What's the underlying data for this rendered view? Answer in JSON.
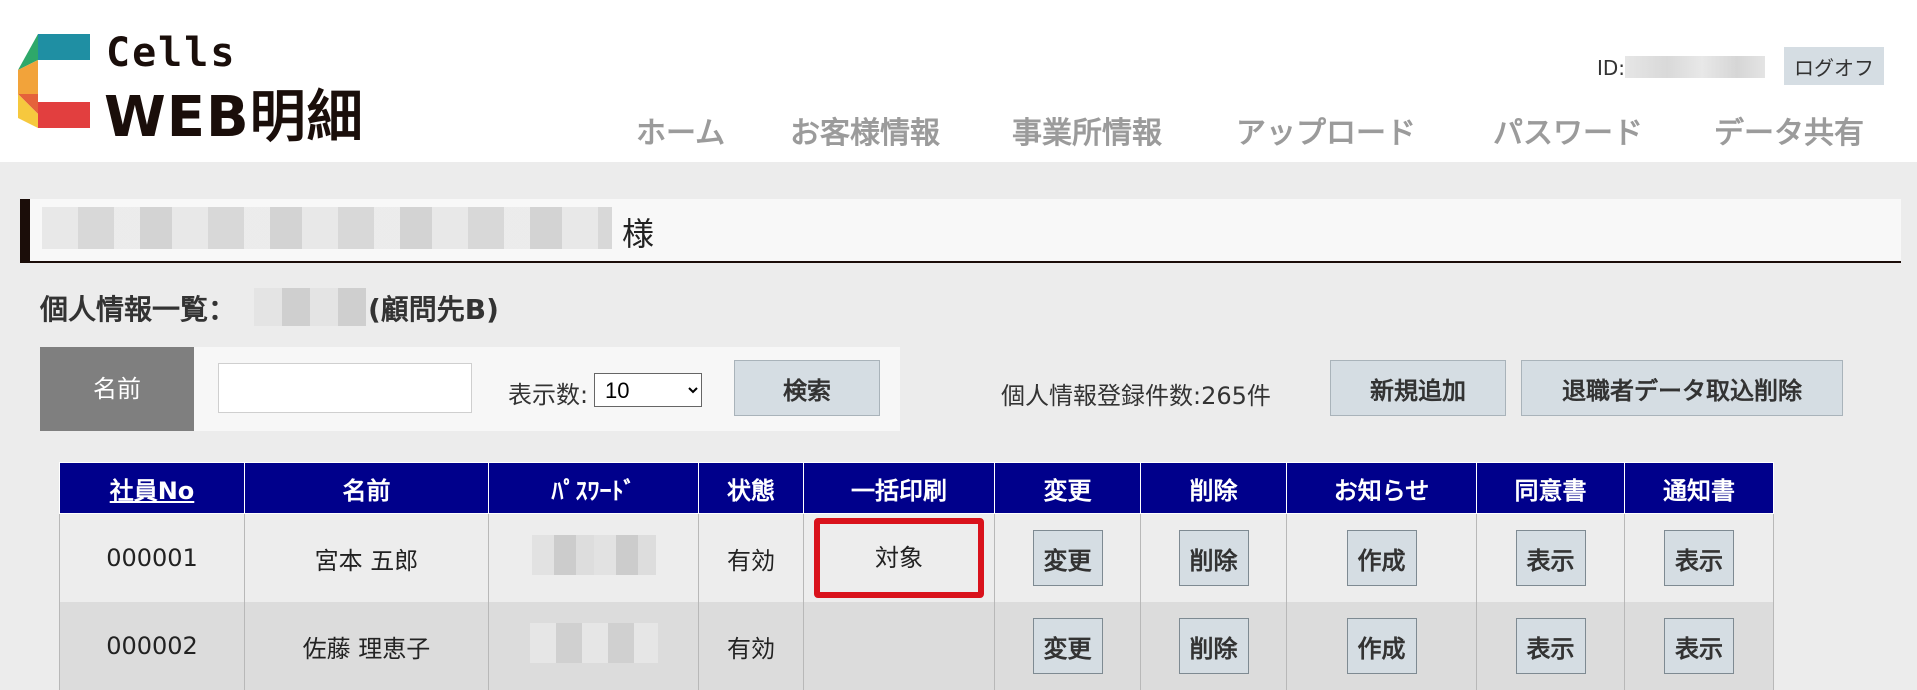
{
  "header": {
    "logo_cells": "Cells",
    "logo_web": "WEB明細",
    "id_label": "ID:",
    "logoff_label": "ログオフ",
    "nav": [
      "ホーム",
      "お客様情報",
      "事業所情報",
      "アップロード",
      "パスワード",
      "データ共有"
    ]
  },
  "title": {
    "suffix": "様"
  },
  "subtitle": {
    "prefix": "個人情報一覧：",
    "client": "(顧問先B)"
  },
  "search": {
    "name_label": "名前",
    "name_value": "",
    "perpage_label": "表示数:",
    "perpage_value": "10",
    "search_label": "検索"
  },
  "actions": {
    "count_text": "個人情報登録件数:265件",
    "add_label": "新規追加",
    "retire_label": "退職者データ取込削除"
  },
  "table": {
    "headers": [
      "社員No",
      "名前",
      "ﾊﾟｽﾜｰﾄﾞ",
      "状態",
      "一括印刷",
      "変更",
      "削除",
      "お知らせ",
      "同意書",
      "通知書"
    ],
    "rows": [
      {
        "no": "000001",
        "name": "宮本 五郎",
        "status": "有効",
        "bulk": "対象",
        "change": "変更",
        "delete": "削除",
        "notice": "作成",
        "consent": "表示",
        "notify": "表示"
      },
      {
        "no": "000002",
        "name": "佐藤 理恵子",
        "status": "有効",
        "bulk": "",
        "change": "変更",
        "delete": "削除",
        "notice": "作成",
        "consent": "表示",
        "notify": "表示"
      }
    ]
  },
  "colors": {
    "header_bg": "#00008b",
    "highlight": "#d9121c",
    "title_accent": "#1b0d09"
  }
}
